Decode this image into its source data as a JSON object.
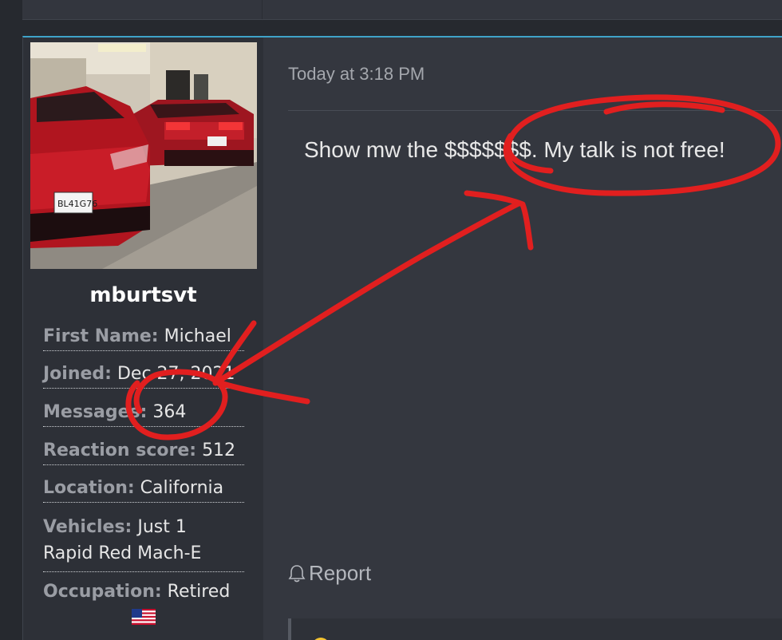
{
  "user": {
    "username": "mburtsvt",
    "fields": [
      {
        "label": "First Name:",
        "value": "Michael"
      },
      {
        "label": "Joined:",
        "value": "Dec 27, 2021"
      },
      {
        "label": "Messages:",
        "value": "364"
      },
      {
        "label": "Reaction score:",
        "value": "512"
      },
      {
        "label": "Location:",
        "value": "California"
      },
      {
        "label": "Vehicles:",
        "value": "Just 1"
      },
      {
        "label": "Occupation:",
        "value": "Retired"
      }
    ],
    "vehicles_line2": "Rapid Red Mach-E",
    "avatar_plate_front": "BL41G76",
    "flag_icon": "us-flag-icon"
  },
  "post": {
    "timestamp": "Today at 3:18 PM",
    "message": "Show mw the $$$$$$$. My talk is not free!",
    "report_label": "Report",
    "report_icon": "bell-icon"
  },
  "colors": {
    "accent": "#3fa3c9",
    "annotation": "#e11f1f",
    "background": "#26292f"
  }
}
